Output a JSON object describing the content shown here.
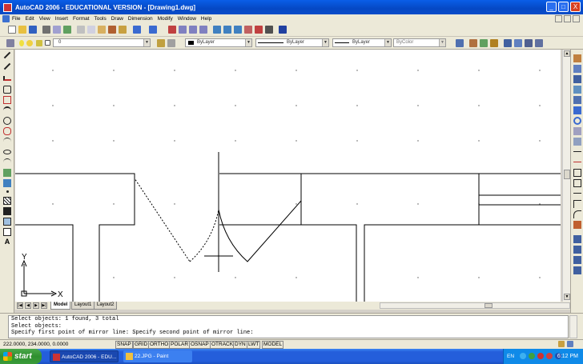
{
  "window": {
    "title": "AutoCAD 2006 - EDUCATIONAL VERSION - [Drawing1.dwg]",
    "minimize": "_",
    "maximize": "□",
    "close": "X"
  },
  "menu": {
    "items": [
      "File",
      "Edit",
      "View",
      "Insert",
      "Format",
      "Tools",
      "Draw",
      "Dimension",
      "Modify",
      "Window",
      "Help"
    ]
  },
  "properties": {
    "layer_value": "0",
    "color_value": "ByLayer",
    "linetype_value": "ByLayer",
    "lineweight_value": "ByLayer",
    "plotstyle_value": "ByColor"
  },
  "ucs": {
    "x_label": "X",
    "y_label": "Y"
  },
  "layout_tabs": [
    "Model",
    "Layout1",
    "Layout2"
  ],
  "command": {
    "lines": [
      "Select objects: 1 found, 3 total",
      "Select objects:",
      "Specify first point of mirror line: Specify second point of mirror line:"
    ]
  },
  "status": {
    "coordinates": "222.0000, 234.0000, 0.0000",
    "toggles": [
      "SNAP",
      "GRID",
      "ORTHO",
      "POLAR",
      "OSNAP",
      "OTRACK",
      "DYN",
      "LWT",
      "MODEL"
    ]
  },
  "taskbar": {
    "start_label": "start",
    "items": [
      "AutoCAD 2006 - EDU...",
      "22.JPG - Paint"
    ],
    "language": "EN",
    "clock": "6:12 PM"
  },
  "colors": {
    "titlebar": "#0548c4",
    "taskbar": "#245edb",
    "start": "#2f8f2f"
  }
}
